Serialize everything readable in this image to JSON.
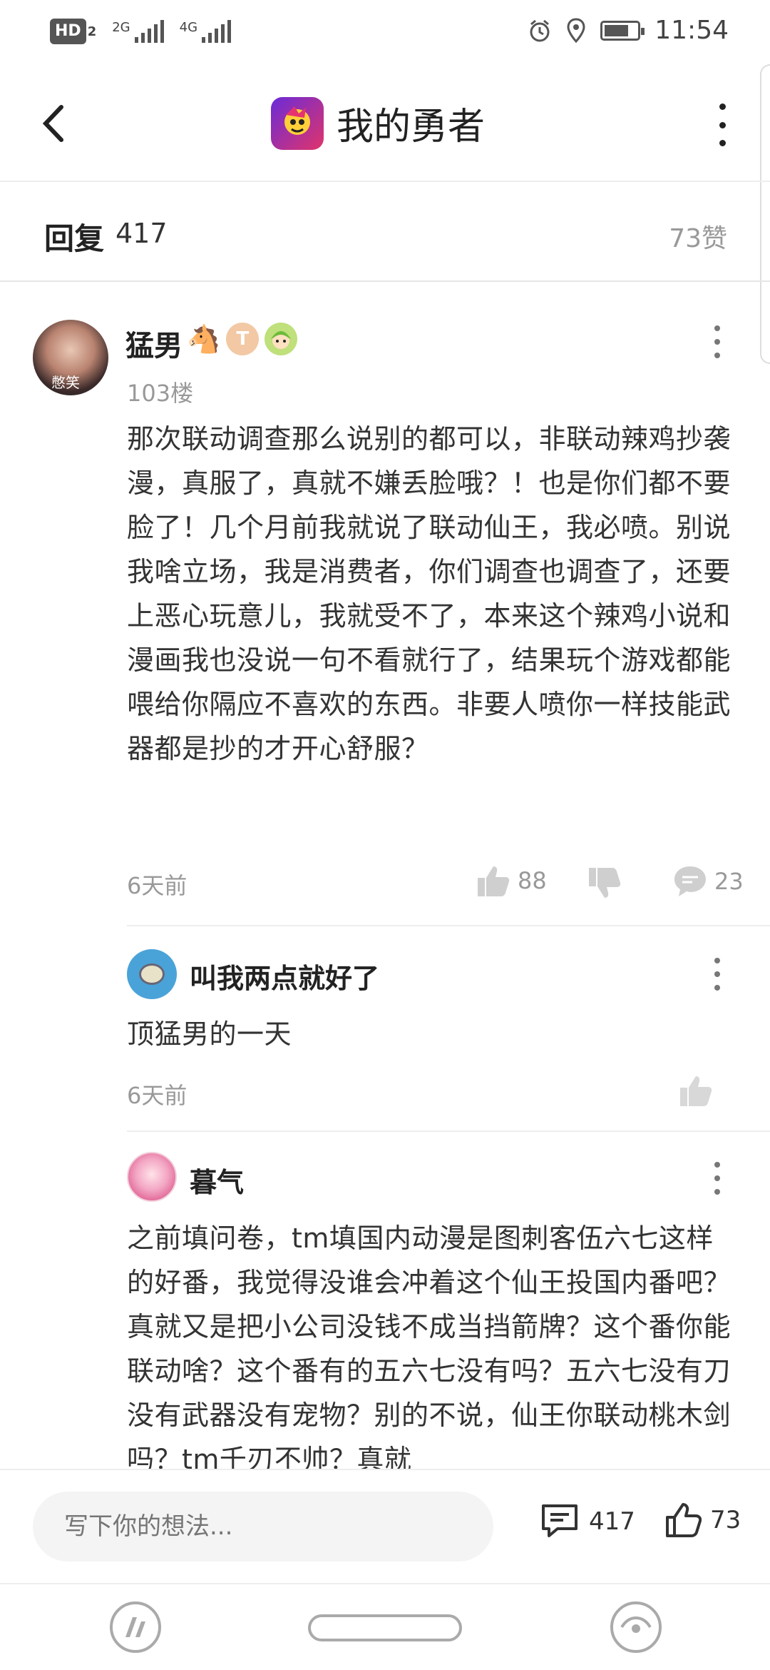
{
  "status_bar": {
    "hd_label": "HD",
    "hd_sub": "2",
    "signal1_label": "2G",
    "signal2_label": "4G",
    "battery_level": 0.75,
    "time": "11:54",
    "icons": [
      "alarm-icon",
      "location-icon",
      "battery-icon"
    ]
  },
  "header": {
    "title": "我的勇者",
    "back_icon": "chevron-left-icon",
    "more_icon": "more-vertical-icon"
  },
  "reply_bar": {
    "label": "回复",
    "count": "417",
    "likes": "73赞"
  },
  "main_comment": {
    "username": "猛男",
    "badges": [
      "horse-emoji",
      "tu-badge",
      "green-hair-avatar-badge"
    ],
    "avatar_caption": "憋笑",
    "floor": "103楼",
    "text": "那次联动调查那么说别的都可以，非联动辣鸡抄袭漫，真服了，真就不嫌丢脸哦？！也是你们都不要脸了！几个月前我就说了联动仙王，我必喷。别说我啥立场，我是消费者，你们调查也调查了，还要上恶心玩意儿，我就受不了，本来这个辣鸡小说和漫画我也没说一句不看就行了，结果玩个游戏都能喂给你隔应不喜欢的东西。非要人喷你一样技能武器都是抄的才开心舒服？",
    "time": "6天前",
    "likes": "88",
    "replies": "23"
  },
  "replies": [
    {
      "username": "叫我两点就好了",
      "text": "顶猛男的一天",
      "time": "6天前"
    },
    {
      "username": "暮气",
      "text": "之前填问卷，tm填国内动漫是图刺客伍六七这样的好番，我觉得没谁会冲着这个仙王投国内番吧？真就又是把小公司没钱不成当挡箭牌？这个番你能联动啥？这个番有的五六七没有吗？五六七没有刀没有武器没有宠物？别的不说，仙王你联动桃木剑吗？tm千刃不帅？真就"
    }
  ],
  "bottom_bar": {
    "input_placeholder": "写下你的想法...",
    "comment_count": "417",
    "like_count": "73"
  },
  "colors": {
    "accent": "#4aa3d8",
    "muted": "#999999",
    "text": "#333333"
  }
}
